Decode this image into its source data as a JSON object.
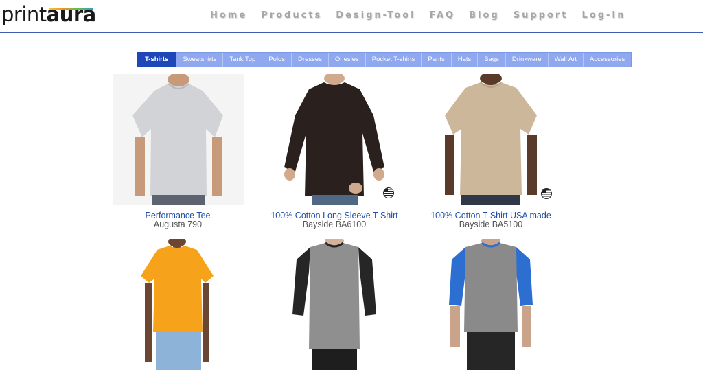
{
  "header": {
    "logo": {
      "part1": "print",
      "part2": "aura"
    },
    "nav": [
      "Home",
      "Products",
      "Design-Tool",
      "FAQ",
      "Blog",
      "Support",
      "Log-In"
    ]
  },
  "categories": {
    "active": "T-shirts",
    "items": [
      "T-shirts",
      "Sweatshirts",
      "Tank Top",
      "Polos",
      "Dresses",
      "Onesies",
      "Pocket T-shirts",
      "Pants",
      "Hats",
      "Bags",
      "Drinkware",
      "Wall Art",
      "Accessories"
    ]
  },
  "products": [
    {
      "name": "Performance Tee",
      "sku": "Augusta 790",
      "shirt_color": "#d2d3d6",
      "usa_made": false
    },
    {
      "name": "100% Cotton Long Sleeve T-Shirt",
      "sku": "Bayside BA6100",
      "shirt_color": "#2a201d",
      "usa_made": true
    },
    {
      "name": "100% Cotton T-Shirt USA made",
      "sku": "Bayside BA5100",
      "shirt_color": "#cdb79b",
      "usa_made": true
    },
    {
      "shirt_color": "#f7a21b"
    },
    {
      "shirt_color": "#8f8f8f",
      "sleeve_color": "#262626"
    },
    {
      "shirt_color": "#8a8a8a",
      "sleeve_color": "#2d6fd1"
    }
  ],
  "colors": {
    "accent": "#1f47b8",
    "tab_bg": "#8fa8ef",
    "link": "#1f4fa8",
    "header_rule": "#3f5fae"
  }
}
